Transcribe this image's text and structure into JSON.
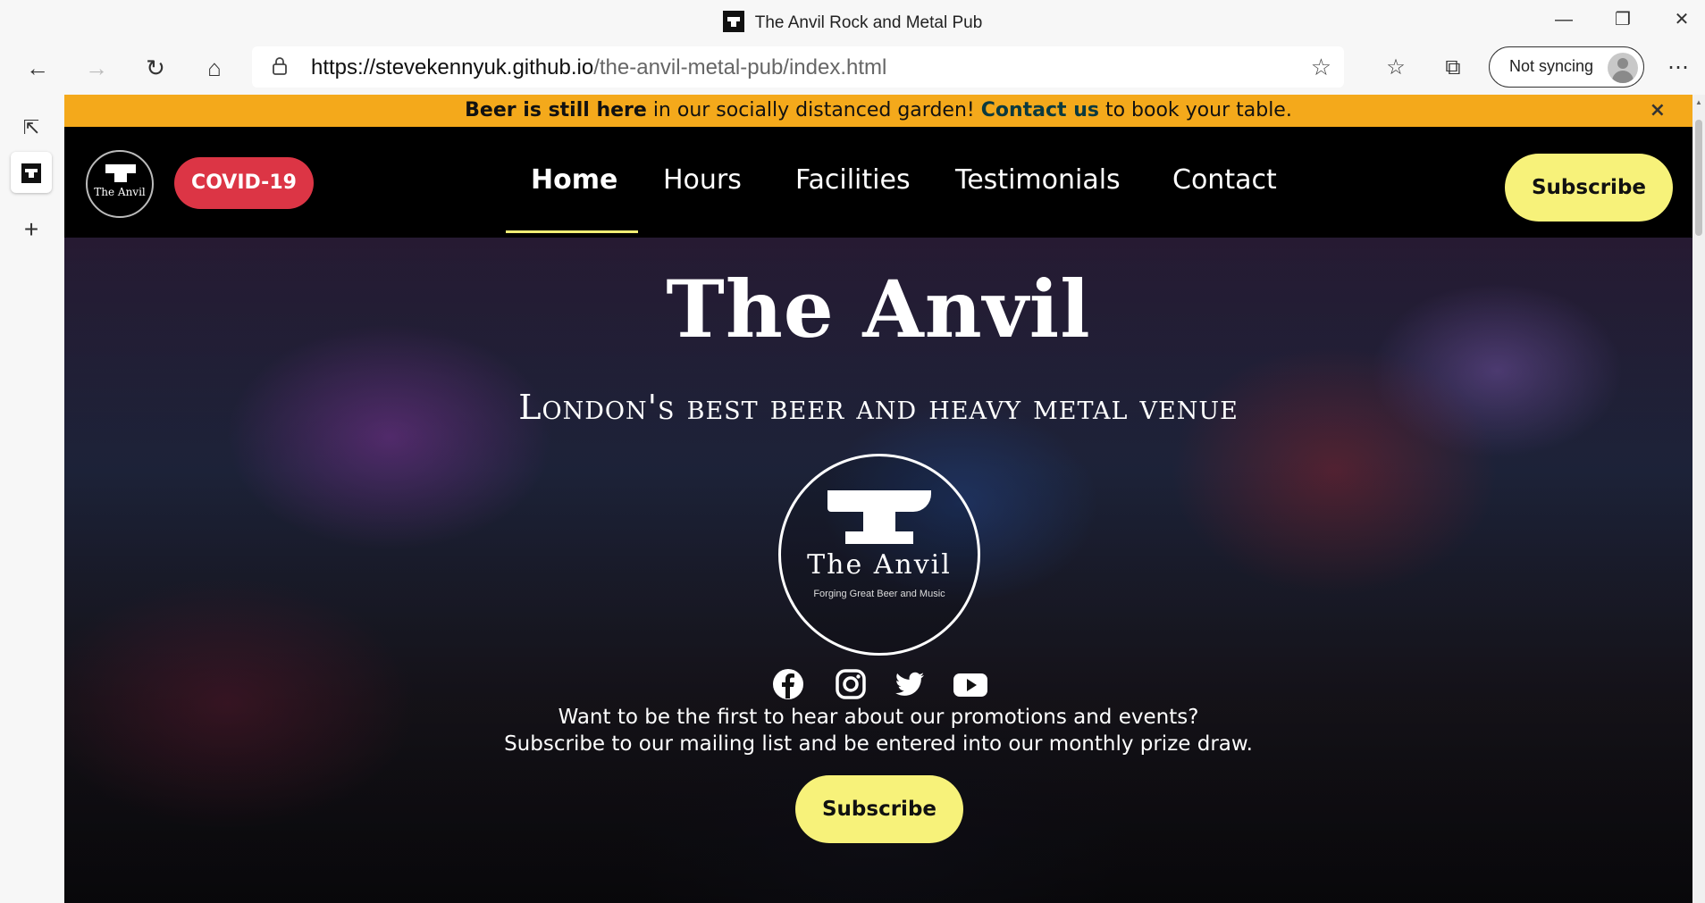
{
  "browser": {
    "window_title": "The Anvil Rock and Metal Pub",
    "url_host": "https://stevekennyuk.github.io",
    "url_path": "/the-anvil-metal-pub/index.html",
    "sync_label": "Not syncing"
  },
  "announcement": {
    "bold_start": "Beer is still here",
    "middle": " in our socially distanced garden! ",
    "link": "Contact us",
    "end": " to book your table.",
    "close": "×"
  },
  "nav": {
    "logo_text": "The Anvil",
    "covid_label": "COVID-19",
    "links": [
      "Home",
      "Hours",
      "Facilities",
      "Testimonials",
      "Contact"
    ],
    "subscribe_label": "Subscribe"
  },
  "hero": {
    "title": "The Anvil",
    "subtitle": "London's best beer and heavy metal venue",
    "logo_name": "The Anvil",
    "logo_tagline": "Forging Great Beer and Music",
    "line1": "Want to be the first to hear about our promotions and events?",
    "line2": "Subscribe to our mailing list and be entered into our monthly prize draw.",
    "subscribe_label": "Subscribe"
  },
  "social_icons": [
    "facebook-icon",
    "instagram-icon",
    "twitter-icon",
    "youtube-icon"
  ],
  "colors": {
    "announcement_bg": "#f4a91b",
    "covid_red": "#dc3545",
    "subscribe_yellow": "#f7f27a",
    "nav_underline": "#f0ed73"
  }
}
